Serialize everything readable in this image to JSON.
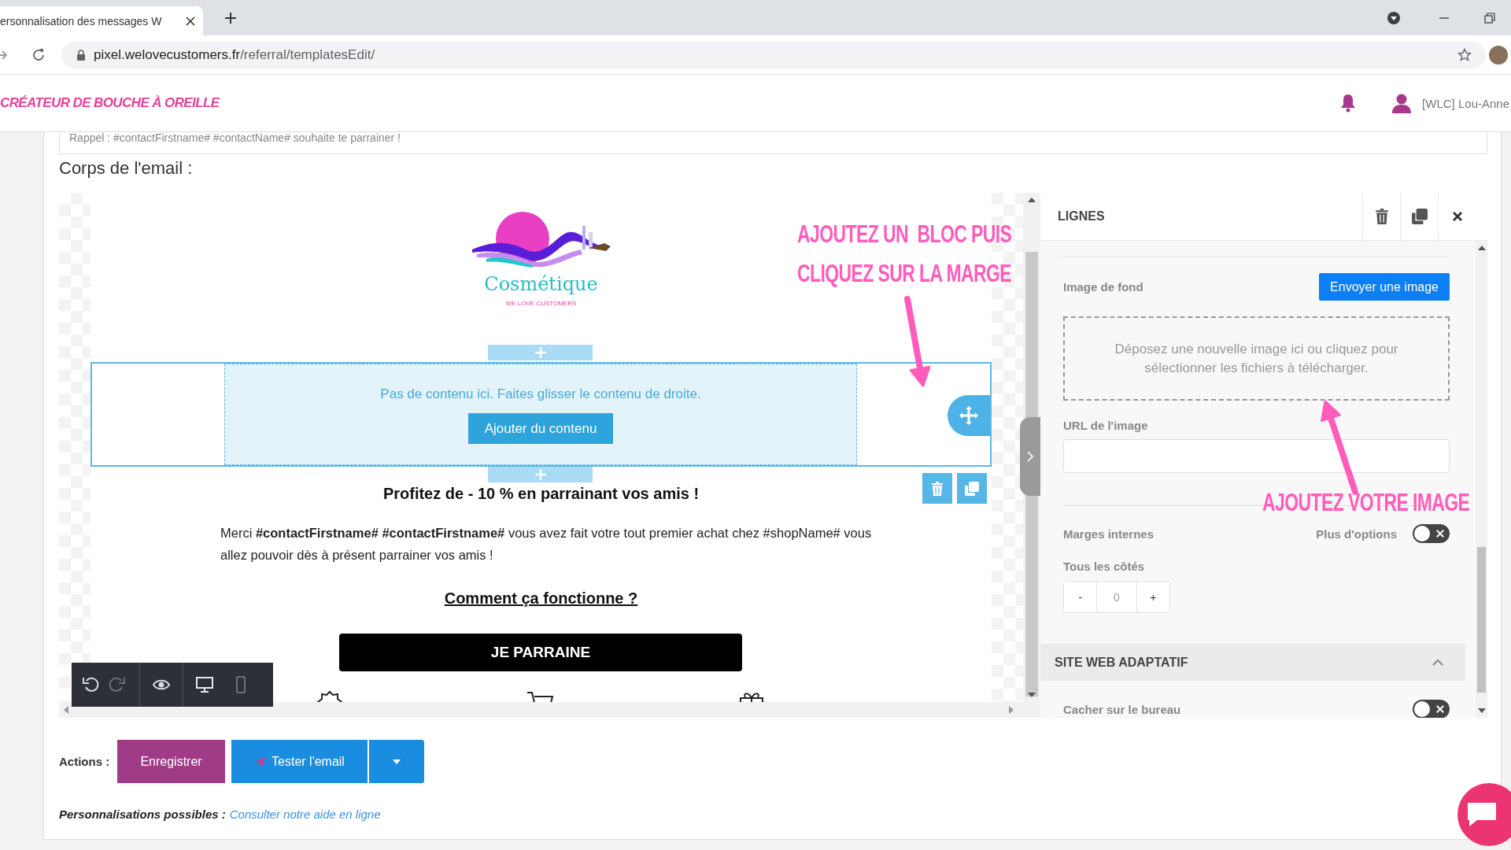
{
  "browser": {
    "tab_title": "ersonnalisation des messages W",
    "url_host": "pixel.welovecustomers.fr",
    "url_path": "/referral/templatesEdit/"
  },
  "header": {
    "title": "CRÉATEUR DE BOUCHE À OREILLE",
    "user": "[WLC] Lou-Anne"
  },
  "subject_field": {
    "value": "Rappel : #contactFirstname# #contactName# souhaite te parrainer !"
  },
  "body_label": "Corps de l'email :",
  "email": {
    "logo": {
      "name": "Cosmétique",
      "tagline": "WE LOVE CUSTOMERS"
    },
    "empty_row": {
      "selected": true,
      "message": "Pas de contenu ici. Faites glisser le contenu de droite.",
      "button": "Ajouter du contenu"
    },
    "headline": "Profitez de - 10 % en parrainant vos amis !",
    "paragraph": "Merci **#contactFirstname# #contactFirstname#** vous avez fait votre tout premier achat chez #shopName# vous allez pouvoir dès à présent parrainer vos amis !",
    "link": "Comment ça fonctionne ?",
    "cta": "JE PARRAINE"
  },
  "toolbar": [
    {
      "kind": "undo",
      "disabled": false
    },
    {
      "kind": "redo",
      "disabled": true
    },
    {
      "kind": "preview"
    },
    {
      "kind": "desktop",
      "selected": true
    },
    {
      "kind": "mobile",
      "selected": false
    }
  ],
  "annotations": [
    {
      "lines": [
        "AJOUTEZ UN  BLOC PUIS",
        "CLIQUEZ SUR LA MARGE"
      ]
    },
    {
      "lines": [
        "AJOUTEZ VOTRE IMAGE"
      ]
    }
  ],
  "panel": {
    "title": "LIGNES",
    "background_image": {
      "label": "Image de fond",
      "button": "Envoyer une image",
      "dropzone": "Déposez une nouvelle image ici ou cliquez pour sélectionner les fichiers à télécharger."
    },
    "image_url": {
      "label": "URL de l'image"
    },
    "padding": {
      "label": "Marges internes",
      "more_options": {
        "label": "Plus d'options",
        "on": false
      },
      "all_sides": {
        "label": "Tous les côtés",
        "minus": "-",
        "value": "0",
        "plus": "+"
      }
    },
    "section": {
      "title": "SITE WEB ADAPTATIF",
      "expanded": true
    },
    "hide_desktop": {
      "label": "Cacher sur le bureau",
      "on": false
    }
  },
  "actions": {
    "label": "Actions :",
    "buttons": [
      {
        "kind": "save",
        "label": "Enregistrer"
      },
      {
        "kind": "test",
        "label": "Tester l'email"
      },
      {
        "kind": "menu"
      }
    ]
  },
  "help": {
    "label": "Personnalisations possibles :",
    "link": "Consulter notre aide en ligne"
  }
}
